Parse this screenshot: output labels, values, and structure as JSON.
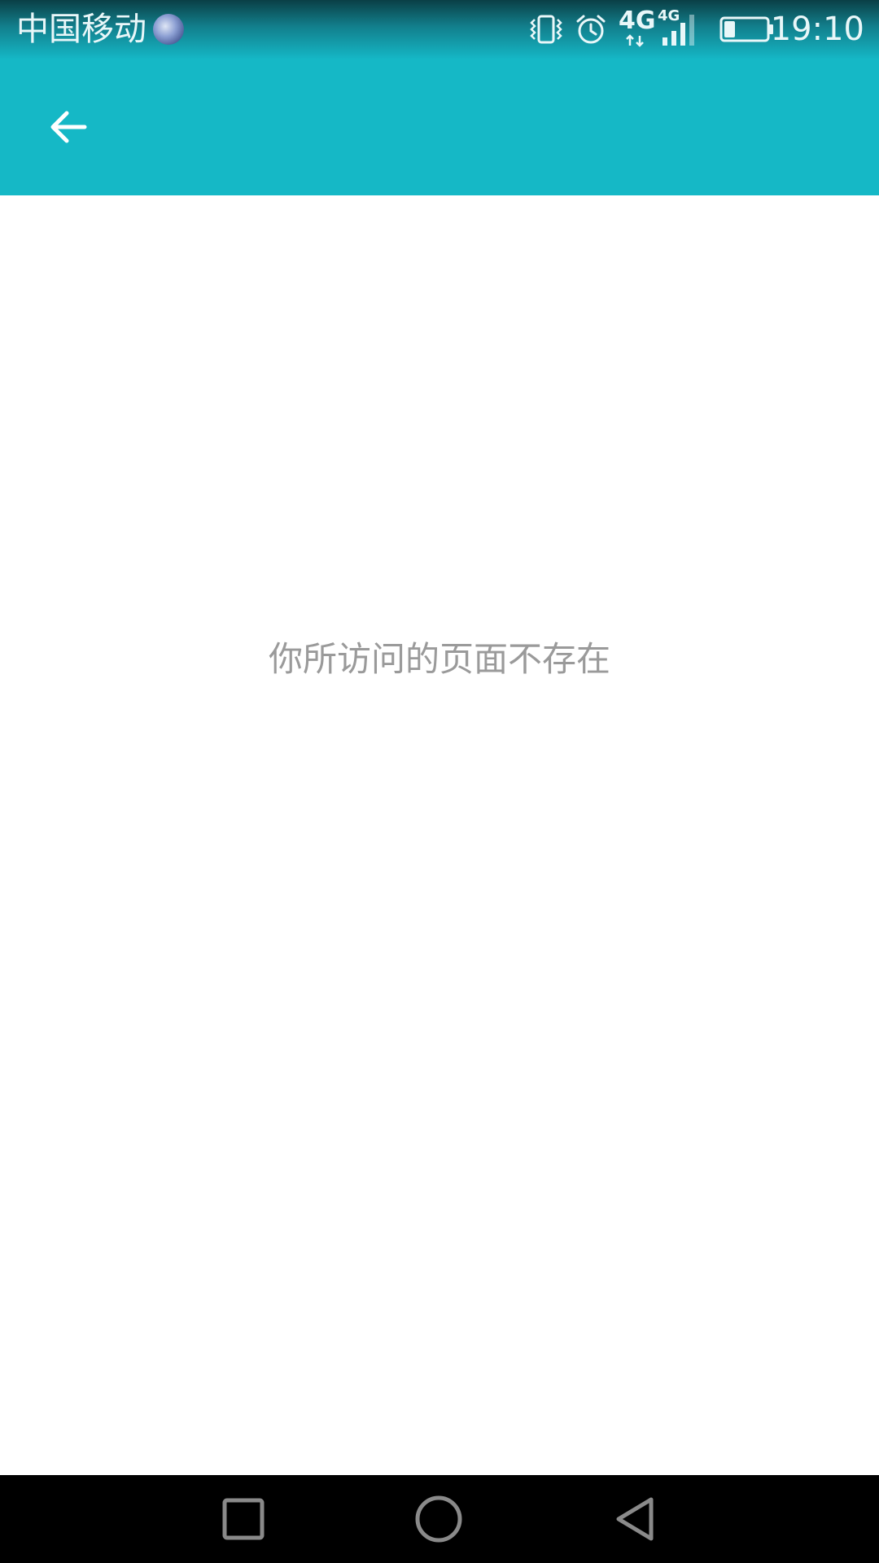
{
  "status_bar": {
    "carrier": "中国移动",
    "network_type": "4G",
    "signal_network_type": "4G",
    "time": "19:10",
    "battery_level": 0.25,
    "icons": [
      "vibrate-icon",
      "alarm-icon",
      "data-4g-icon",
      "signal-icon",
      "battery-icon"
    ]
  },
  "app_bar": {
    "back_icon": "arrow-left-icon",
    "color": "#15b8c6"
  },
  "content": {
    "message": "你所访问的页面不存在",
    "message_color": "#9a9a9a"
  },
  "nav_bar": {
    "buttons": [
      "recent-apps",
      "home",
      "back"
    ]
  }
}
